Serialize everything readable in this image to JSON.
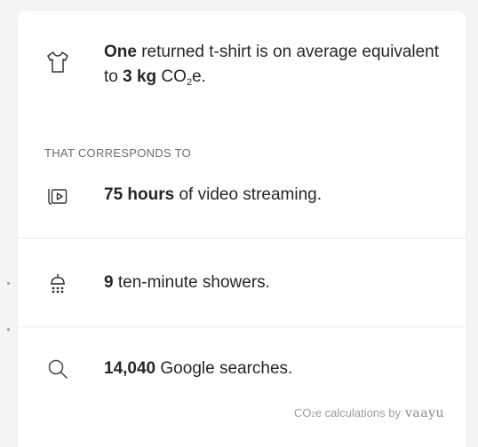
{
  "intro": {
    "bold_lead": "One",
    "text_1": " returned t-shirt is on average equivalent to ",
    "bold_amount": "3 kg",
    "unit_prefix": " CO",
    "unit_sub": "2",
    "unit_suffix": "e.",
    "icon": "tshirt-icon"
  },
  "section_label": "THAT CORRESPONDS TO",
  "items": [
    {
      "icon": "video-streaming-icon",
      "bold": "75 hours",
      "text": " of video streaming."
    },
    {
      "icon": "shower-icon",
      "bold": "9",
      "text": " ten-minute showers."
    },
    {
      "icon": "search-icon",
      "bold": "14,040",
      "text": " Google searches."
    }
  ],
  "credit": {
    "prefix": "CO",
    "sub": "2",
    "suffix": "e calculations by",
    "brand": "vaayu"
  },
  "colors": {
    "background": "#f4f4f4",
    "card": "#ffffff",
    "text": "#262626",
    "muted": "#6e6e6e",
    "divider": "#ececec"
  }
}
